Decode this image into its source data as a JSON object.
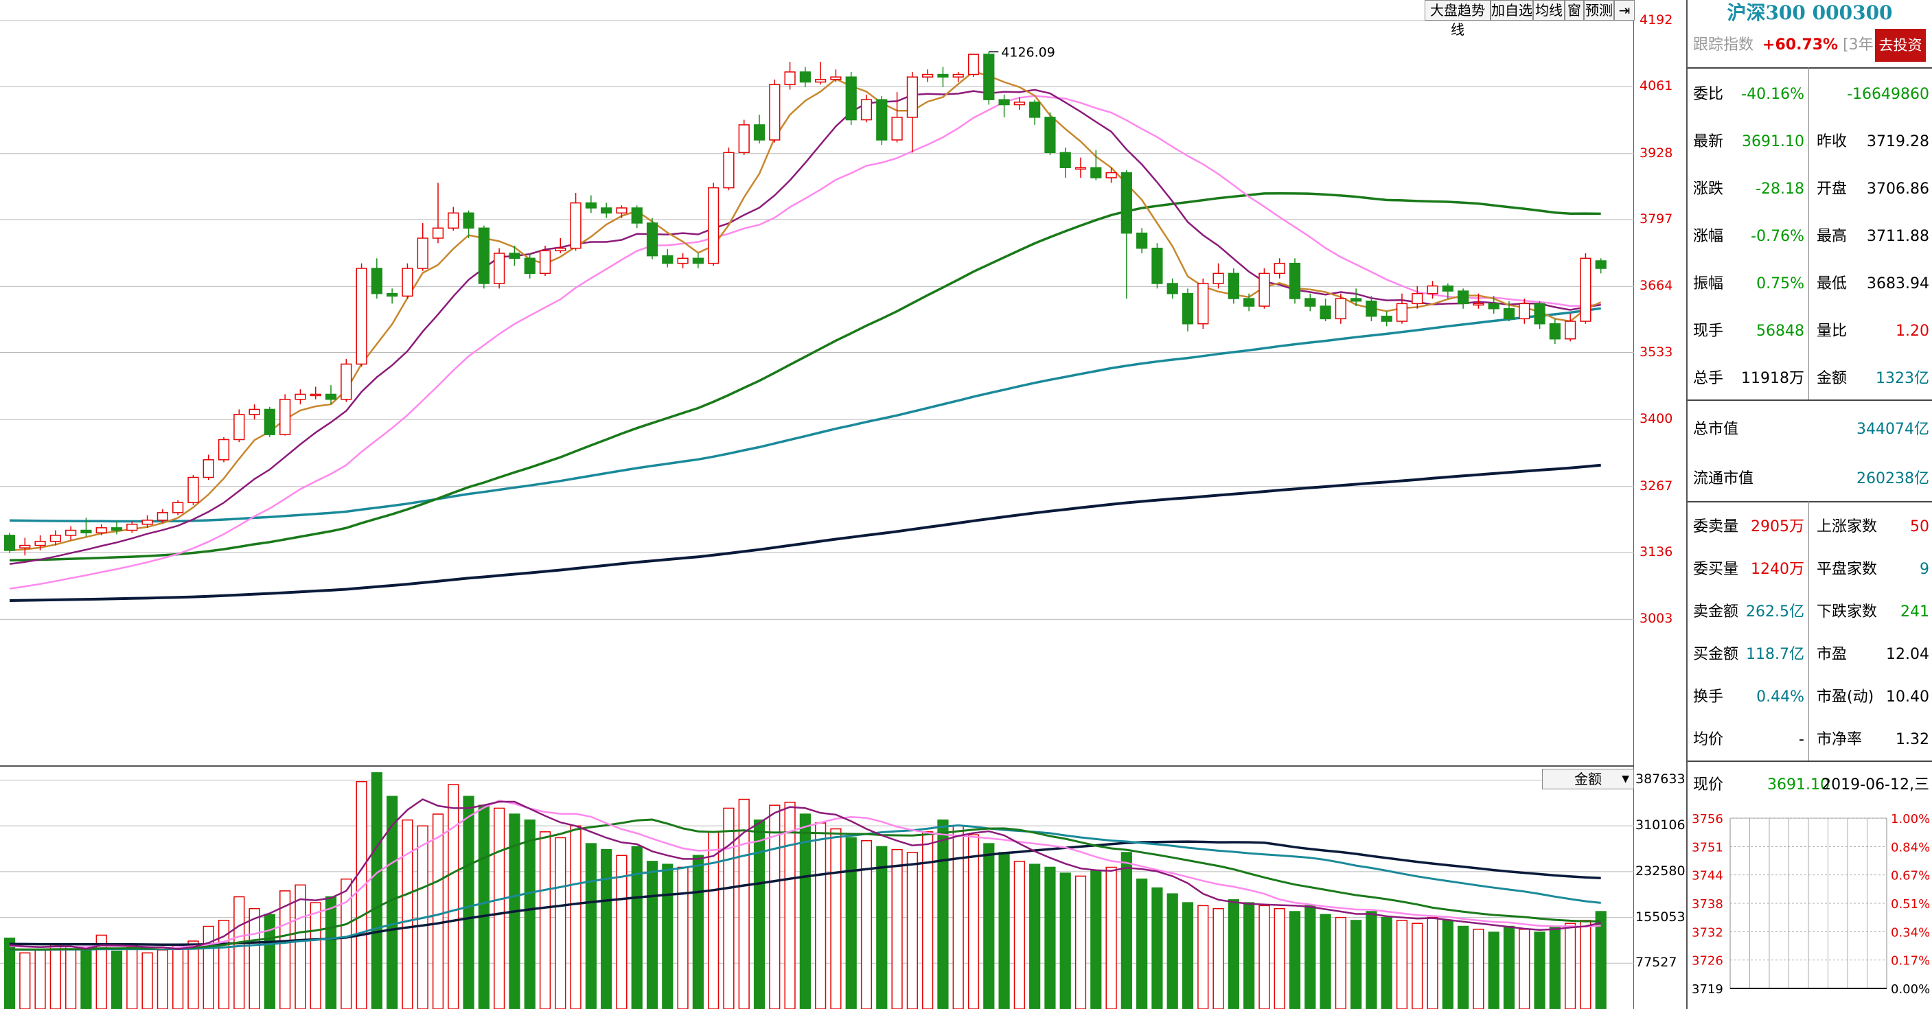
{
  "toolbar": {
    "buttons": [
      "大盘趋势线",
      "加自选",
      "均线",
      "窗",
      "预测"
    ],
    "pin_icon": "pin-icon"
  },
  "main_chart": {
    "price_axis": [
      "4192",
      "4061",
      "3928",
      "3797",
      "3664",
      "3533",
      "3400",
      "3267",
      "3136",
      "3003"
    ],
    "high_marker": "4126.09",
    "volume_axis": [
      "387633",
      "310106",
      "232580",
      "155053",
      "77527"
    ],
    "volume_selector": "金额",
    "colors": {
      "up": "#e60000",
      "down": "#1a8f1a",
      "ma5": "#c8872e",
      "ma10": "#8b1a7a",
      "ma20": "#ff88ee",
      "ma60": "#1a7a1a",
      "ma120": "#1a8a9a",
      "ma250": "#0a1a3a"
    }
  },
  "panel": {
    "title": "沪深300 000300",
    "track_label": "跟踪指数",
    "track_value": "+60.73%",
    "track_period": "[3年]",
    "invest_button": "去投资",
    "rows1": [
      {
        "l1": "委比",
        "v1": "-40.16%",
        "l2": "",
        "v2": "-16649860"
      },
      {
        "l1": "最新",
        "v1": "3691.10",
        "l2": "昨收",
        "v2": "3719.28"
      },
      {
        "l1": "涨跌",
        "v1": "-28.18",
        "l2": "开盘",
        "v2": "3706.86"
      },
      {
        "l1": "涨幅",
        "v1": "-0.76%",
        "l2": "最高",
        "v2": "3711.88"
      },
      {
        "l1": "振幅",
        "v1": "0.75%",
        "l2": "最低",
        "v2": "3683.94"
      },
      {
        "l1": "现手",
        "v1": "56848",
        "l2": "量比",
        "v2": "1.20"
      },
      {
        "l1": "总手",
        "v1": "11918万",
        "l2": "金额",
        "v2": "1323亿"
      }
    ],
    "rows2": [
      {
        "l1": "总市值",
        "v1": "344074亿"
      },
      {
        "l1": "流通市值",
        "v1": "260238亿"
      }
    ],
    "rows3": [
      {
        "l1": "委卖量",
        "v1": "2905万",
        "l2": "上涨家数",
        "v2": "50"
      },
      {
        "l1": "委买量",
        "v1": "1240万",
        "l2": "平盘家数",
        "v2": "9"
      },
      {
        "l1": "卖金额",
        "v1": "262.5亿",
        "l2": "下跌家数",
        "v2": "241"
      },
      {
        "l1": "买金额",
        "v1": "118.7亿",
        "l2": "市盈",
        "v2": "12.04"
      },
      {
        "l1": "换手",
        "v1": "0.44%",
        "l2": "市盈(动)",
        "v2": "10.40"
      },
      {
        "l1": "均价",
        "v1": "-",
        "l2": "市净率",
        "v2": "1.32"
      }
    ],
    "now_label": "现价",
    "now_value": "3691.10",
    "date": "2019-06-12,三",
    "mini_axis_left": [
      "3756",
      "3751",
      "3744",
      "3738",
      "3732",
      "3726",
      "3719"
    ],
    "mini_axis_right": [
      "1.00%",
      "0.84%",
      "0.67%",
      "0.51%",
      "0.34%",
      "0.17%",
      "0.00%"
    ]
  },
  "chart_data": {
    "type": "candlestick",
    "price_min": 2870,
    "price_max": 4192,
    "volume_max": 430000,
    "candles": [
      [
        3170,
        3140,
        3175,
        3135
      ],
      [
        3145,
        3150,
        3165,
        3130
      ],
      [
        3150,
        3158,
        3170,
        3140
      ],
      [
        3158,
        3170,
        3180,
        3150
      ],
      [
        3170,
        3180,
        3188,
        3160
      ],
      [
        3180,
        3175,
        3205,
        3168
      ],
      [
        3175,
        3185,
        3192,
        3170
      ],
      [
        3185,
        3180,
        3198,
        3172
      ],
      [
        3180,
        3192,
        3198,
        3175
      ],
      [
        3192,
        3200,
        3210,
        3185
      ],
      [
        3200,
        3215,
        3222,
        3195
      ],
      [
        3215,
        3235,
        3240,
        3210
      ],
      [
        3235,
        3285,
        3290,
        3230
      ],
      [
        3285,
        3320,
        3330,
        3280
      ],
      [
        3320,
        3360,
        3365,
        3315
      ],
      [
        3360,
        3410,
        3420,
        3355
      ],
      [
        3410,
        3420,
        3430,
        3400
      ],
      [
        3420,
        3370,
        3425,
        3365
      ],
      [
        3370,
        3440,
        3450,
        3368
      ],
      [
        3440,
        3450,
        3460,
        3430
      ],
      [
        3450,
        3450,
        3465,
        3440
      ],
      [
        3450,
        3440,
        3468,
        3430
      ],
      [
        3440,
        3510,
        3520,
        3435
      ],
      [
        3510,
        3700,
        3710,
        3505
      ],
      [
        3700,
        3650,
        3720,
        3640
      ],
      [
        3650,
        3645,
        3660,
        3630
      ],
      [
        3645,
        3700,
        3710,
        3640
      ],
      [
        3700,
        3760,
        3790,
        3695
      ],
      [
        3760,
        3780,
        3870,
        3750
      ],
      [
        3780,
        3810,
        3822,
        3775
      ],
      [
        3810,
        3780,
        3815,
        3760
      ],
      [
        3780,
        3670,
        3785,
        3660
      ],
      [
        3670,
        3730,
        3740,
        3660
      ],
      [
        3730,
        3720,
        3745,
        3705
      ],
      [
        3720,
        3690,
        3730,
        3680
      ],
      [
        3690,
        3735,
        3745,
        3685
      ],
      [
        3735,
        3740,
        3760,
        3730
      ],
      [
        3740,
        3830,
        3850,
        3735
      ],
      [
        3830,
        3820,
        3845,
        3810
      ],
      [
        3820,
        3810,
        3830,
        3800
      ],
      [
        3810,
        3820,
        3825,
        3800
      ],
      [
        3820,
        3790,
        3825,
        3780
      ],
      [
        3790,
        3725,
        3800,
        3718
      ],
      [
        3725,
        3710,
        3738,
        3702
      ],
      [
        3710,
        3720,
        3730,
        3700
      ],
      [
        3720,
        3710,
        3730,
        3700
      ],
      [
        3710,
        3860,
        3870,
        3705
      ],
      [
        3860,
        3930,
        3940,
        3855
      ],
      [
        3930,
        3985,
        3995,
        3925
      ],
      [
        3985,
        3955,
        4005,
        3948
      ],
      [
        3955,
        4065,
        4075,
        3950
      ],
      [
        4065,
        4090,
        4110,
        4055
      ],
      [
        4090,
        4070,
        4100,
        4060
      ],
      [
        4070,
        4075,
        4110,
        4065
      ],
      [
        4075,
        4080,
        4095,
        4070
      ],
      [
        4080,
        3995,
        4090,
        3985
      ],
      [
        3995,
        4035,
        4045,
        3990
      ],
      [
        4035,
        3955,
        4042,
        3945
      ],
      [
        3955,
        4000,
        4050,
        3950
      ],
      [
        4000,
        4080,
        4090,
        3930
      ],
      [
        4080,
        4085,
        4095,
        4070
      ],
      [
        4085,
        4080,
        4100,
        4060
      ],
      [
        4080,
        4085,
        4090,
        4070
      ],
      [
        4085,
        4125,
        4126,
        4080
      ],
      [
        4125,
        4035,
        4130,
        4025
      ],
      [
        4035,
        4025,
        4045,
        4000
      ],
      [
        4025,
        4030,
        4040,
        4015
      ],
      [
        4030,
        4000,
        4035,
        3985
      ],
      [
        4000,
        3930,
        4010,
        3925
      ],
      [
        3930,
        3900,
        3940,
        3880
      ],
      [
        3900,
        3900,
        3920,
        3880
      ],
      [
        3900,
        3880,
        3935,
        3875
      ],
      [
        3880,
        3890,
        3900,
        3870
      ],
      [
        3890,
        3770,
        3895,
        3640
      ],
      [
        3770,
        3740,
        3780,
        3730
      ],
      [
        3740,
        3670,
        3750,
        3660
      ],
      [
        3670,
        3650,
        3680,
        3640
      ],
      [
        3650,
        3590,
        3660,
        3575
      ],
      [
        3590,
        3670,
        3680,
        3580
      ],
      [
        3670,
        3690,
        3710,
        3660
      ],
      [
        3690,
        3640,
        3700,
        3630
      ],
      [
        3640,
        3625,
        3650,
        3615
      ],
      [
        3625,
        3690,
        3700,
        3620
      ],
      [
        3690,
        3710,
        3720,
        3680
      ],
      [
        3710,
        3640,
        3720,
        3630
      ],
      [
        3640,
        3625,
        3650,
        3615
      ],
      [
        3625,
        3600,
        3640,
        3595
      ],
      [
        3600,
        3640,
        3650,
        3590
      ],
      [
        3640,
        3635,
        3660,
        3625
      ],
      [
        3635,
        3605,
        3645,
        3595
      ],
      [
        3605,
        3595,
        3615,
        3585
      ],
      [
        3595,
        3630,
        3650,
        3590
      ],
      [
        3630,
        3650,
        3665,
        3620
      ],
      [
        3650,
        3665,
        3675,
        3640
      ],
      [
        3665,
        3655,
        3670,
        3640
      ],
      [
        3655,
        3630,
        3660,
        3620
      ],
      [
        3630,
        3630,
        3650,
        3620
      ],
      [
        3630,
        3620,
        3645,
        3610
      ],
      [
        3620,
        3600,
        3635,
        3595
      ],
      [
        3600,
        3630,
        3640,
        3590
      ],
      [
        3630,
        3590,
        3635,
        3580
      ],
      [
        3590,
        3560,
        3600,
        3550
      ],
      [
        3560,
        3595,
        3610,
        3555
      ],
      [
        3595,
        3720,
        3730,
        3590
      ],
      [
        3715,
        3700,
        3720,
        3690
      ]
    ],
    "volumes": [
      120000,
      95000,
      100000,
      110000,
      105000,
      100000,
      125000,
      98000,
      105000,
      95000,
      100000,
      110000,
      115000,
      140000,
      150000,
      190000,
      170000,
      160000,
      200000,
      210000,
      180000,
      190000,
      220000,
      385000,
      400000,
      360000,
      320000,
      310000,
      330000,
      380000,
      360000,
      345000,
      340000,
      330000,
      320000,
      300000,
      290000,
      310000,
      280000,
      270000,
      260000,
      275000,
      250000,
      245000,
      240000,
      260000,
      300000,
      340000,
      355000,
      320000,
      345000,
      350000,
      330000,
      315000,
      305000,
      290000,
      285000,
      275000,
      270000,
      265000,
      300000,
      320000,
      310000,
      295000,
      280000,
      265000,
      250000,
      245000,
      240000,
      230000,
      225000,
      235000,
      240000,
      265000,
      220000,
      205000,
      195000,
      180000,
      175000,
      170000,
      185000,
      180000,
      175000,
      170000,
      165000,
      175000,
      160000,
      155000,
      150000,
      165000,
      155000,
      150000,
      145000,
      155000,
      150000,
      140000,
      135000,
      130000,
      140000,
      135000,
      130000,
      140000,
      145000,
      150000,
      165000
    ]
  }
}
